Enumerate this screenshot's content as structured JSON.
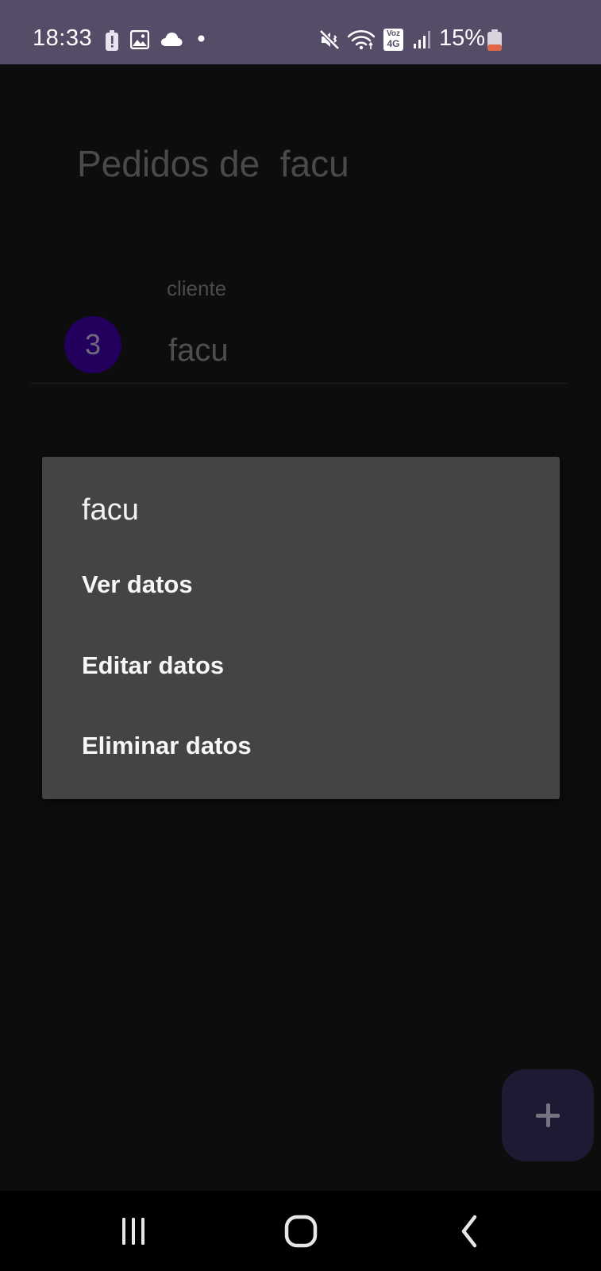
{
  "status_bar": {
    "time": "18:33",
    "battery_percent": "15%",
    "background_color": "#554c67",
    "left_icons": [
      "battery-alert-icon",
      "gallery-icon",
      "cloud-icon",
      "notification-dot-icon"
    ],
    "right_icons": [
      "mute-vibrate-icon",
      "wifi-icon",
      "volte-4g-icon",
      "signal-icon",
      "battery-icon"
    ],
    "network_badge_top": "Voz",
    "network_badge_bottom": "4G"
  },
  "page": {
    "title": "Pedidos de  facu",
    "orders": [
      {
        "number": "3",
        "label": "cliente",
        "name": "facu"
      }
    ]
  },
  "dialog": {
    "title": "facu",
    "items": [
      {
        "label": "Ver datos"
      },
      {
        "label": "Editar datos"
      },
      {
        "label": "Eliminar datos"
      }
    ]
  },
  "fab": {
    "icon": "plus-icon"
  },
  "nav_bar": {
    "buttons": [
      "recent-apps-icon",
      "home-icon",
      "back-icon"
    ]
  },
  "colors": {
    "accent": "#24005e",
    "dialog_background": "#444444",
    "fab_background": "#1f1933",
    "battery_low": "#e0664a"
  }
}
